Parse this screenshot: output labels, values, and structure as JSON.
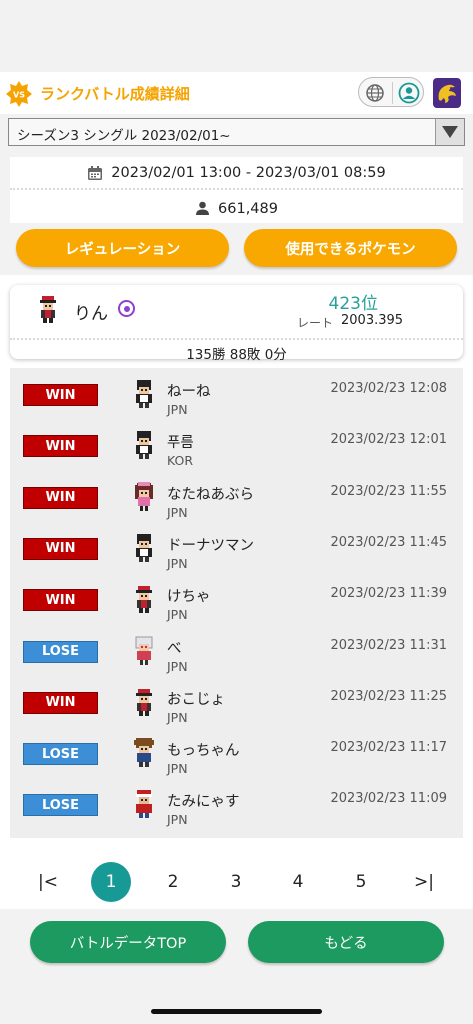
{
  "header": {
    "badge": "VS",
    "title": "ランクバトル成績詳細",
    "icons": [
      "globe-icon",
      "user-icon",
      "game-logo"
    ]
  },
  "season": {
    "selected": "シーズン3 シングル 2023/02/01~"
  },
  "info": {
    "period": "2023/02/01 13:00 - 2023/03/01 08:59",
    "participants": "661,489"
  },
  "buttons": {
    "regulation": "レギュレーション",
    "usable_pokemon": "使用できるポケモン",
    "battle_data_top": "バトルデータTOP",
    "back": "もどる"
  },
  "player": {
    "name": "りん",
    "rank": "423位",
    "rate_label": "レート",
    "rate": "2003.395",
    "record": "135勝 88敗 0分"
  },
  "battles": [
    {
      "result": "WIN",
      "name": "ねーね",
      "country": "JPN",
      "date": "2023/02/23 12:08",
      "sprite": "black-hair"
    },
    {
      "result": "WIN",
      "name": "푸름",
      "country": "KOR",
      "date": "2023/02/23 12:01",
      "sprite": "black-hair"
    },
    {
      "result": "WIN",
      "name": "なたねあぶら",
      "country": "JPN",
      "date": "2023/02/23 11:55",
      "sprite": "pink-girl"
    },
    {
      "result": "WIN",
      "name": "ドーナツマン",
      "country": "JPN",
      "date": "2023/02/23 11:45",
      "sprite": "black-hair"
    },
    {
      "result": "WIN",
      "name": "けちゃ",
      "country": "JPN",
      "date": "2023/02/23 11:39",
      "sprite": "red-cap"
    },
    {
      "result": "LOSE",
      "name": "べ",
      "country": "JPN",
      "date": "2023/02/23 11:31",
      "sprite": "white-hair"
    },
    {
      "result": "WIN",
      "name": "おこじょ",
      "country": "JPN",
      "date": "2023/02/23 11:25",
      "sprite": "red-cap"
    },
    {
      "result": "LOSE",
      "name": "もっちゃん",
      "country": "JPN",
      "date": "2023/02/23 11:17",
      "sprite": "brown-hair"
    },
    {
      "result": "LOSE",
      "name": "たみにゃす",
      "country": "JPN",
      "date": "2023/02/23 11:09",
      "sprite": "red-boy"
    }
  ],
  "pager": {
    "first": "|<",
    "pages": [
      "1",
      "2",
      "3",
      "4",
      "5"
    ],
    "last": ">|",
    "current": "1"
  },
  "colors": {
    "accent_yellow": "#f8a800",
    "rank_teal": "#2aa198",
    "win_red": "#c00000",
    "lose_blue": "#3c8fd6",
    "button_green": "#1d9a5f",
    "page_active": "#179a96"
  }
}
